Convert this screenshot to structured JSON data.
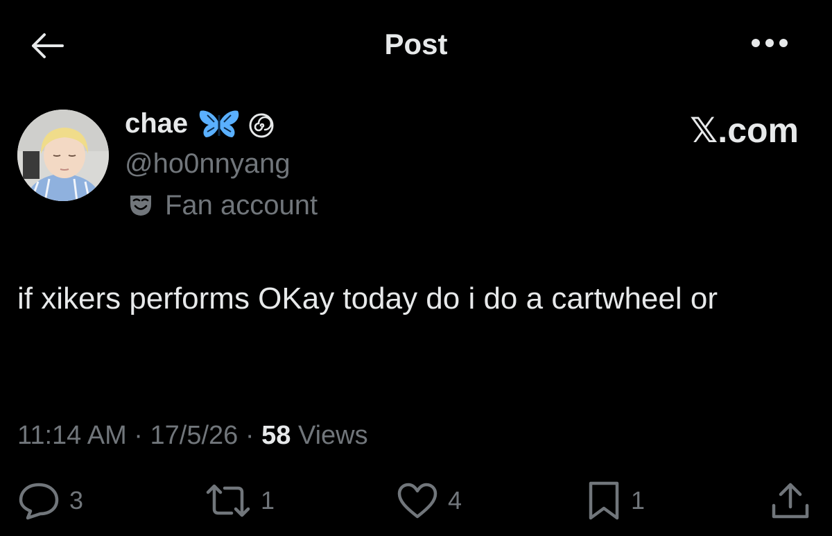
{
  "header": {
    "title": "Post"
  },
  "author": {
    "display_name": "chae",
    "handle": "@ho0nnyang",
    "account_label": "Fan account"
  },
  "site_mark": "𝕏.com",
  "post": {
    "text": "if xikers performs OKay today do i do a cartwheel or"
  },
  "meta": {
    "time": "11:14 AM",
    "date": "17/5/26",
    "separator": "·",
    "views_count": "58",
    "views_label": "Views"
  },
  "actions": {
    "replies": "3",
    "reposts": "1",
    "likes": "4",
    "bookmarks": "1"
  },
  "colors": {
    "background": "#000000",
    "primary_text": "#e7e9ea",
    "secondary_text": "#71767b",
    "butterfly": "#5ab0ff"
  }
}
